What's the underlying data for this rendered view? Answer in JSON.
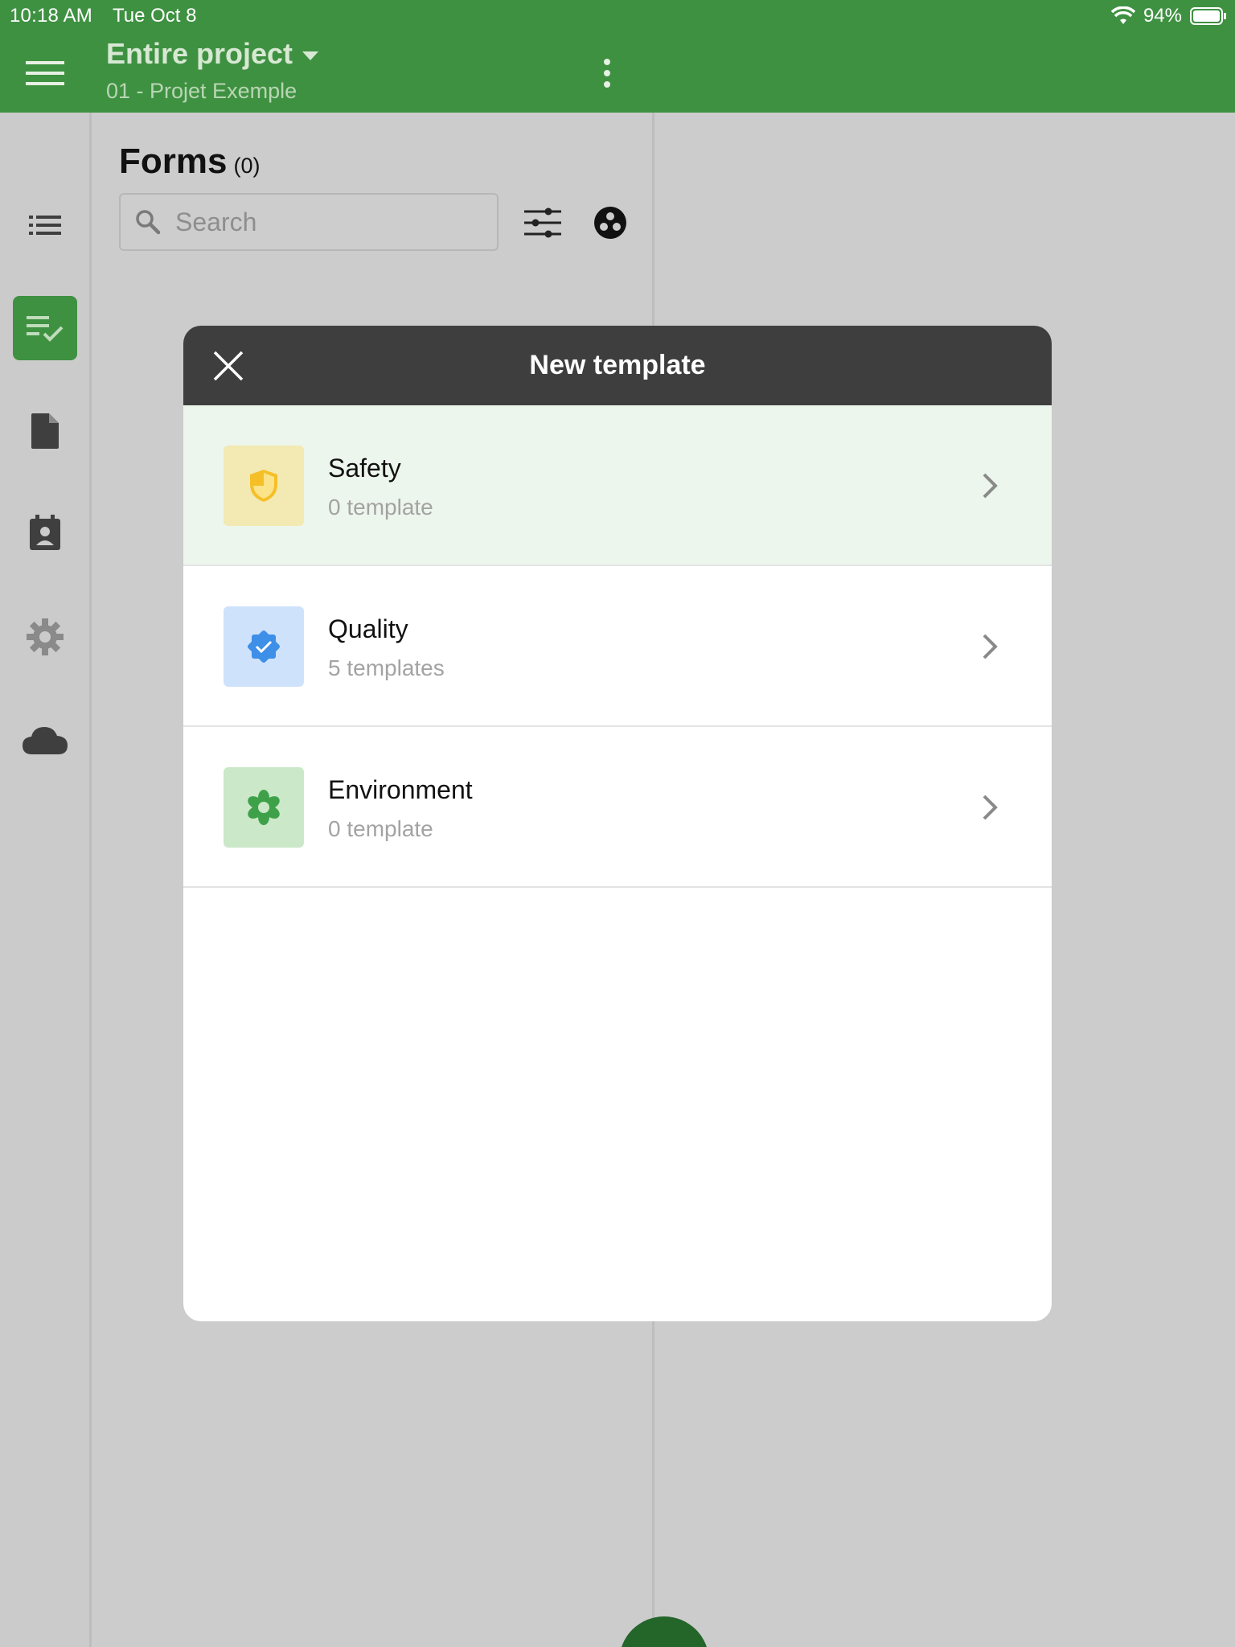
{
  "status_bar": {
    "time": "10:18 AM",
    "date": "Tue Oct 8",
    "battery": "94%"
  },
  "app_bar": {
    "scope_title": "Entire project",
    "project_name": "01 - Projet Exemple"
  },
  "forms_panel": {
    "title": "Forms",
    "count": "(0)",
    "search_placeholder": "Search"
  },
  "modal": {
    "title": "New template",
    "categories": [
      {
        "name": "Safety",
        "count": "0 template",
        "icon": "shield-icon",
        "tile_color": "#f2e9b3",
        "icon_color": "#f5bf27"
      },
      {
        "name": "Quality",
        "count": "5 templates",
        "icon": "verified-badge-icon",
        "tile_color": "#cfe2fb",
        "icon_color": "#3d8fe8"
      },
      {
        "name": "Environment",
        "count": "0 template",
        "icon": "flower-icon",
        "tile_color": "#cbe8c9",
        "icon_color": "#3ea14a"
      }
    ]
  },
  "fab": {
    "label": "+"
  },
  "colors": {
    "primary": "#3f9142",
    "modal_header": "#3e3e3e",
    "fab": "#24652a"
  }
}
